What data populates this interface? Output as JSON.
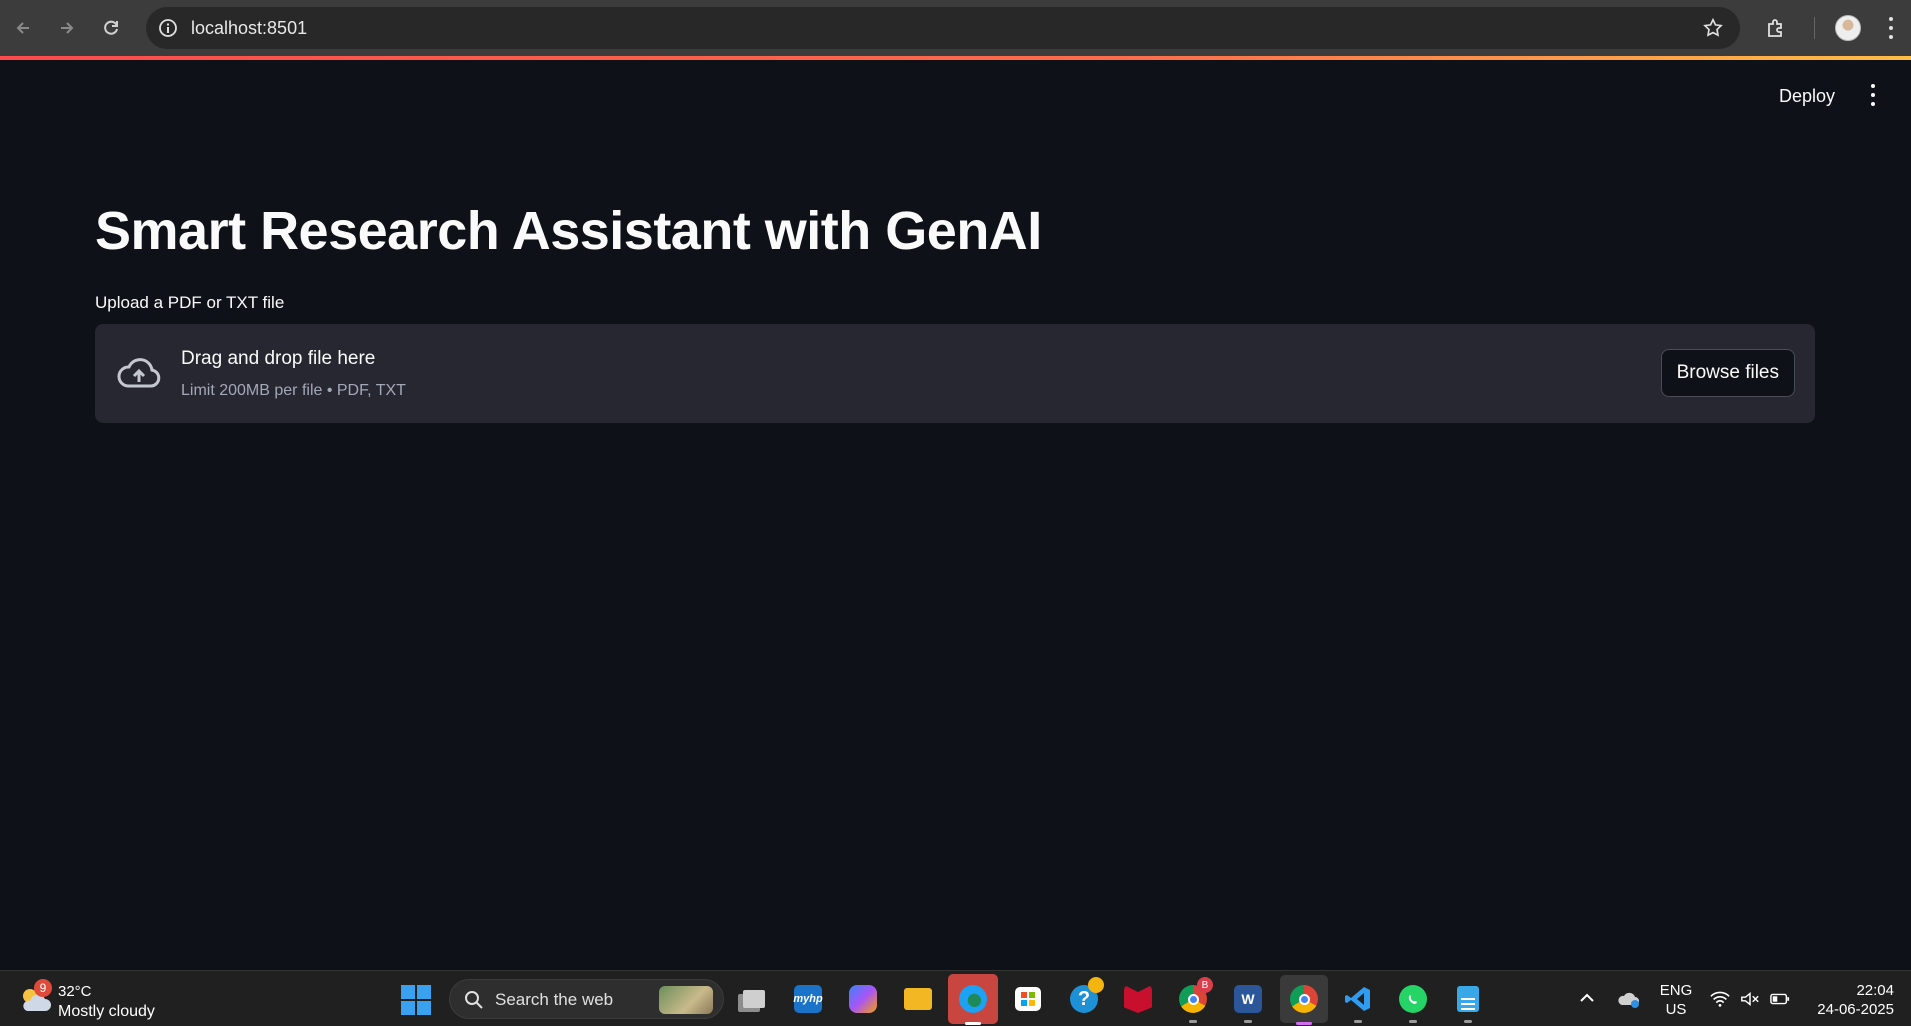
{
  "browser": {
    "url": "localhost:8501"
  },
  "app": {
    "deploy_label": "Deploy",
    "title": "Smart Research Assistant with GenAI",
    "uploader": {
      "label": "Upload a PDF or TXT file",
      "drop_text": "Drag and drop file here",
      "limit_text": "Limit 200MB per file • PDF, TXT",
      "browse_label": "Browse files"
    }
  },
  "taskbar": {
    "weather": {
      "badge": "9",
      "temperature": "32°C",
      "condition": "Mostly cloudy"
    },
    "search_placeholder": "Search the web",
    "apps": [
      {
        "name": "task-view",
        "icon": "task-view-icon"
      },
      {
        "name": "myhp",
        "icon": "myhp-icon",
        "label": "myhp"
      },
      {
        "name": "copilot",
        "icon": "copilot-icon"
      },
      {
        "name": "file-explorer",
        "icon": "folder-icon"
      },
      {
        "name": "edge",
        "icon": "edge-icon"
      },
      {
        "name": "store",
        "icon": "store-icon"
      },
      {
        "name": "help",
        "icon": "help-icon"
      },
      {
        "name": "mcafee",
        "icon": "mcafee-icon"
      },
      {
        "name": "chrome-profile",
        "icon": "chrome-icon",
        "badge": "B"
      },
      {
        "name": "word",
        "icon": "word-icon",
        "label": "W"
      },
      {
        "name": "chrome",
        "icon": "chrome-icon"
      },
      {
        "name": "vscode",
        "icon": "vscode-icon"
      },
      {
        "name": "whatsapp",
        "icon": "whatsapp-icon"
      },
      {
        "name": "notepad",
        "icon": "notepad-icon"
      }
    ],
    "tray": {
      "lang_top": "ENG",
      "lang_bottom": "US",
      "time": "22:04",
      "date": "24-06-2025"
    }
  }
}
